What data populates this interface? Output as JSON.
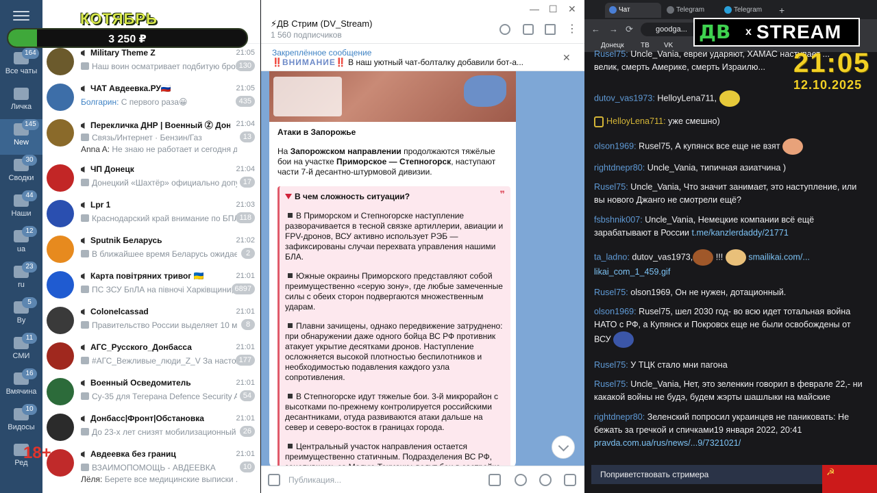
{
  "rail": {
    "items": [
      {
        "label": "Все чаты",
        "badge": "164"
      },
      {
        "label": "Личка",
        "badge": ""
      },
      {
        "label": "New",
        "badge": "145"
      },
      {
        "label": "Сводки",
        "badge": "30"
      },
      {
        "label": "Наши",
        "badge": "44"
      },
      {
        "label": "ua",
        "badge": "12"
      },
      {
        "label": "ru",
        "badge": "23"
      },
      {
        "label": "By",
        "badge": "5"
      },
      {
        "label": "СМИ",
        "badge": "11"
      },
      {
        "label": "Вмячина",
        "badge": "16"
      },
      {
        "label": "Видосы",
        "badge": "10"
      },
      {
        "label": "Ред",
        "badge": ""
      }
    ]
  },
  "overlay": {
    "month": "КОТЯБРЬ",
    "amount": "3 250 ₽",
    "progress_fraction": 0.12,
    "age": "18+"
  },
  "chats": [
    {
      "title": "Military Theme Z",
      "time": "21:05",
      "preview": "Наш воин осматривает подбитую бро...",
      "count": "130",
      "color": "#6b5a2c"
    },
    {
      "title": "ЧАТ Авдеевка.РУ🇷🇺",
      "time": "21:05",
      "preview_sender": "Болгарин:",
      "preview": " С первого раза😀",
      "count": "435",
      "color": "#3d6ea8"
    },
    {
      "title": "Перекличка ДНР | Военный Ⓩ Доне...",
      "time": "21:04",
      "preview": "Связь/Интернет  ·  Бензин/Газ",
      "preview2_sender": "Anna A:",
      "preview2": " Не знаю не работает и сегодня д...",
      "count": "13",
      "color": "#8a6a2a"
    },
    {
      "title": "ЧП Донецк",
      "time": "21:04",
      "preview": "Донецкий «Шахтёр» официально допу...",
      "count": "17",
      "color": "#c22626"
    },
    {
      "title": "Lpr 1",
      "time": "21:03",
      "preview": "Краснодарский край внимание по БПЛА ...",
      "count": "118",
      "color": "#2a4fb0"
    },
    {
      "title": "Sputnik Беларусь",
      "time": "21:02",
      "preview": "В ближайшее время Беларусь ожидает ...",
      "count": "2",
      "color": "#e78a1e"
    },
    {
      "title": "Карта повітряних тривог 🇺🇦",
      "time": "21:01",
      "preview": "ПС ЗСУ  БпЛА на півночі Харківщини, ...",
      "count": "6897",
      "color": "#1f5bd1"
    },
    {
      "title": "Colonelcassad",
      "time": "21:01",
      "preview": "Правительство России выделяет 10 млр...",
      "count": "8",
      "color": "#3a3a3a"
    },
    {
      "title": "АГС_Русского_Донбасса",
      "time": "21:01",
      "preview": "#АГС_Вежливые_люди_Z_V  За настоя...",
      "count": "177",
      "color": "#a0281e"
    },
    {
      "title": "Военный Осведомитель",
      "time": "21:01",
      "preview": "Су-35 для Тегерана  Defence Security Asia ...",
      "count": "54",
      "color": "#2c6b3a"
    },
    {
      "title": "Донбасс|Фронт|Обстановка",
      "time": "21:01",
      "preview": "До 23-х лет снизят мобилизационный в...",
      "count": "26",
      "color": "#2b2b2b"
    },
    {
      "title": "Авдеевка без границ",
      "time": "21:01",
      "preview": "ВЗАИМОПОМОЩЬ - АВДЕЕВКА",
      "preview2_sender": "Лёля:",
      "preview2": " Берете все медицинские выписки ...",
      "count": "10",
      "color": "#c02a2a"
    }
  ],
  "pane": {
    "title": "⚡ДВ Стрим (DV_Stream)",
    "subscribers": "1 560 подписчиков",
    "pinned_label": "Закреплённое сообщение",
    "pinned_flag_left": "‼️",
    "pinned_warning": "ВНИМАНИЕ",
    "pinned_flag_right": "‼️",
    "pinned_text": " В наш уютный чат-болталку добавили бот-а...",
    "heading": "Атаки в Запорожье",
    "intro_a": "На ",
    "intro_b": "Запорожском направлении",
    "intro_c": " продолжаются тяжёлые бои на участке ",
    "intro_d": "Приморское — Степногорск",
    "intro_e": ", наступают части 7-й десантно-штурмовой дивизии.",
    "quote_heading": "В чем сложность ситуации?",
    "quote_mark": "❞",
    "bullets": [
      "В Приморском и Степногорске наступление разворачивается в тесной связке артиллерии, авиации и FPV-дронов, ВСУ активно использует РЭБ — зафиксированы случаи перехвата управления нашими БЛА.",
      "Южные окраины Приморского представляют собой преимущественно «серую зону», где любые замеченные силы с обеих сторон подвергаются множественным ударам.",
      "Плавни зачищены, однако передвижение затруднено: при обнаружении даже одного бойца ВС РФ противник атакует укрытие десятками дронов. Наступление осложняется высокой плотностью беспилотников и необходимостью подавления каждого узла сопротивления.",
      "В Степногорске идут тяжелые бои. 3-й микрорайон с высотками по-прежнему контролируется российскими десантниками, отуда развиваются атаки дальше на север и северо-восток в границах города.",
      "Центральный участок направления остается преимущественно статичным. Подразделения ВС РФ, зацепившись за Малую Токмачку, ведут бои в застройке и лесополосах южнее."
    ],
    "compose_placeholder": "Публикация..."
  },
  "browser": {
    "tabs": [
      "Чат",
      "Telegram",
      "Telegram"
    ],
    "url": "goodga...",
    "bookmarks": [
      "Донецк",
      "ТВ",
      "VK"
    ],
    "logo_left": "ДВ",
    "logo_x": "x",
    "logo_right": "STREAM",
    "clock": "21:05",
    "date": "12.10.2025",
    "greet": "Поприветствовать стримера"
  },
  "stream_chat": [
    {
      "user": "Rusel75:",
      "text": " Uncle_Vania, евреи ударяют, ХАМАС наступает ...",
      "line2": "велик, смерть Америке, смерть Израилю..."
    },
    {
      "user": "dutov_vas1973:",
      "text": " HelloyLena711,"
    },
    {
      "user": "HelloyLena711:",
      "text": " уже смешно)",
      "gold": true
    },
    {
      "user": "olson1969:",
      "text": " Rusel75, А купянск все еще не взят"
    },
    {
      "user": "rightdnepr80:",
      "text": " Uncle_Vania, типичная азиатчина )"
    },
    {
      "user": "Rusel75:",
      "text": " Uncle_Vania, Что значит занимает, это наступление, или вы нового Джанго не смотрели ещё?"
    },
    {
      "user": "fsbshnik007:",
      "text": " Uncle_Vania, Немецкие компании всё ещё зарабатывают в России ",
      "link": "t.me/kanzlerdaddy/21771"
    },
    {
      "user": "ta_ladno:",
      "text": " dutov_vas1973,",
      "text2": " !!! ",
      "link": "smailikai.com/...",
      "line2_link": "likai_com_1_459.gif"
    },
    {
      "user": "Rusel75:",
      "text": " olson1969, Он не нужен, дотационный."
    },
    {
      "user": "olson1969:",
      "text": " Rusel75, шел 2030 год- во всю идет тотальная война НАТО с РФ, а Купянск и Покровск еще не были освобождены от ВСУ"
    },
    {
      "user": "Rusel75:",
      "text": " У ТЦК стало мни пагона"
    },
    {
      "user": "Rusel75:",
      "text": " Uncle_Vania, Нет, это зеленкин говорил в феврале 22,- ни какакой войны не будэ, будем жэрты шашлыки на майские"
    },
    {
      "user": "rightdnepr80:",
      "text": " Зеленский попросил украинцев не паниковать: Не бежать за гречкой и спичками19 января 2022, 20:41 ",
      "link": "pravda.com.ua/rus/news/...9/7321021/"
    }
  ],
  "colors": {
    "rail": "#2b4a6b",
    "pane_bg": "#7ea7d6",
    "stream_bg": "#18181b",
    "accent": "#3e82c4"
  }
}
